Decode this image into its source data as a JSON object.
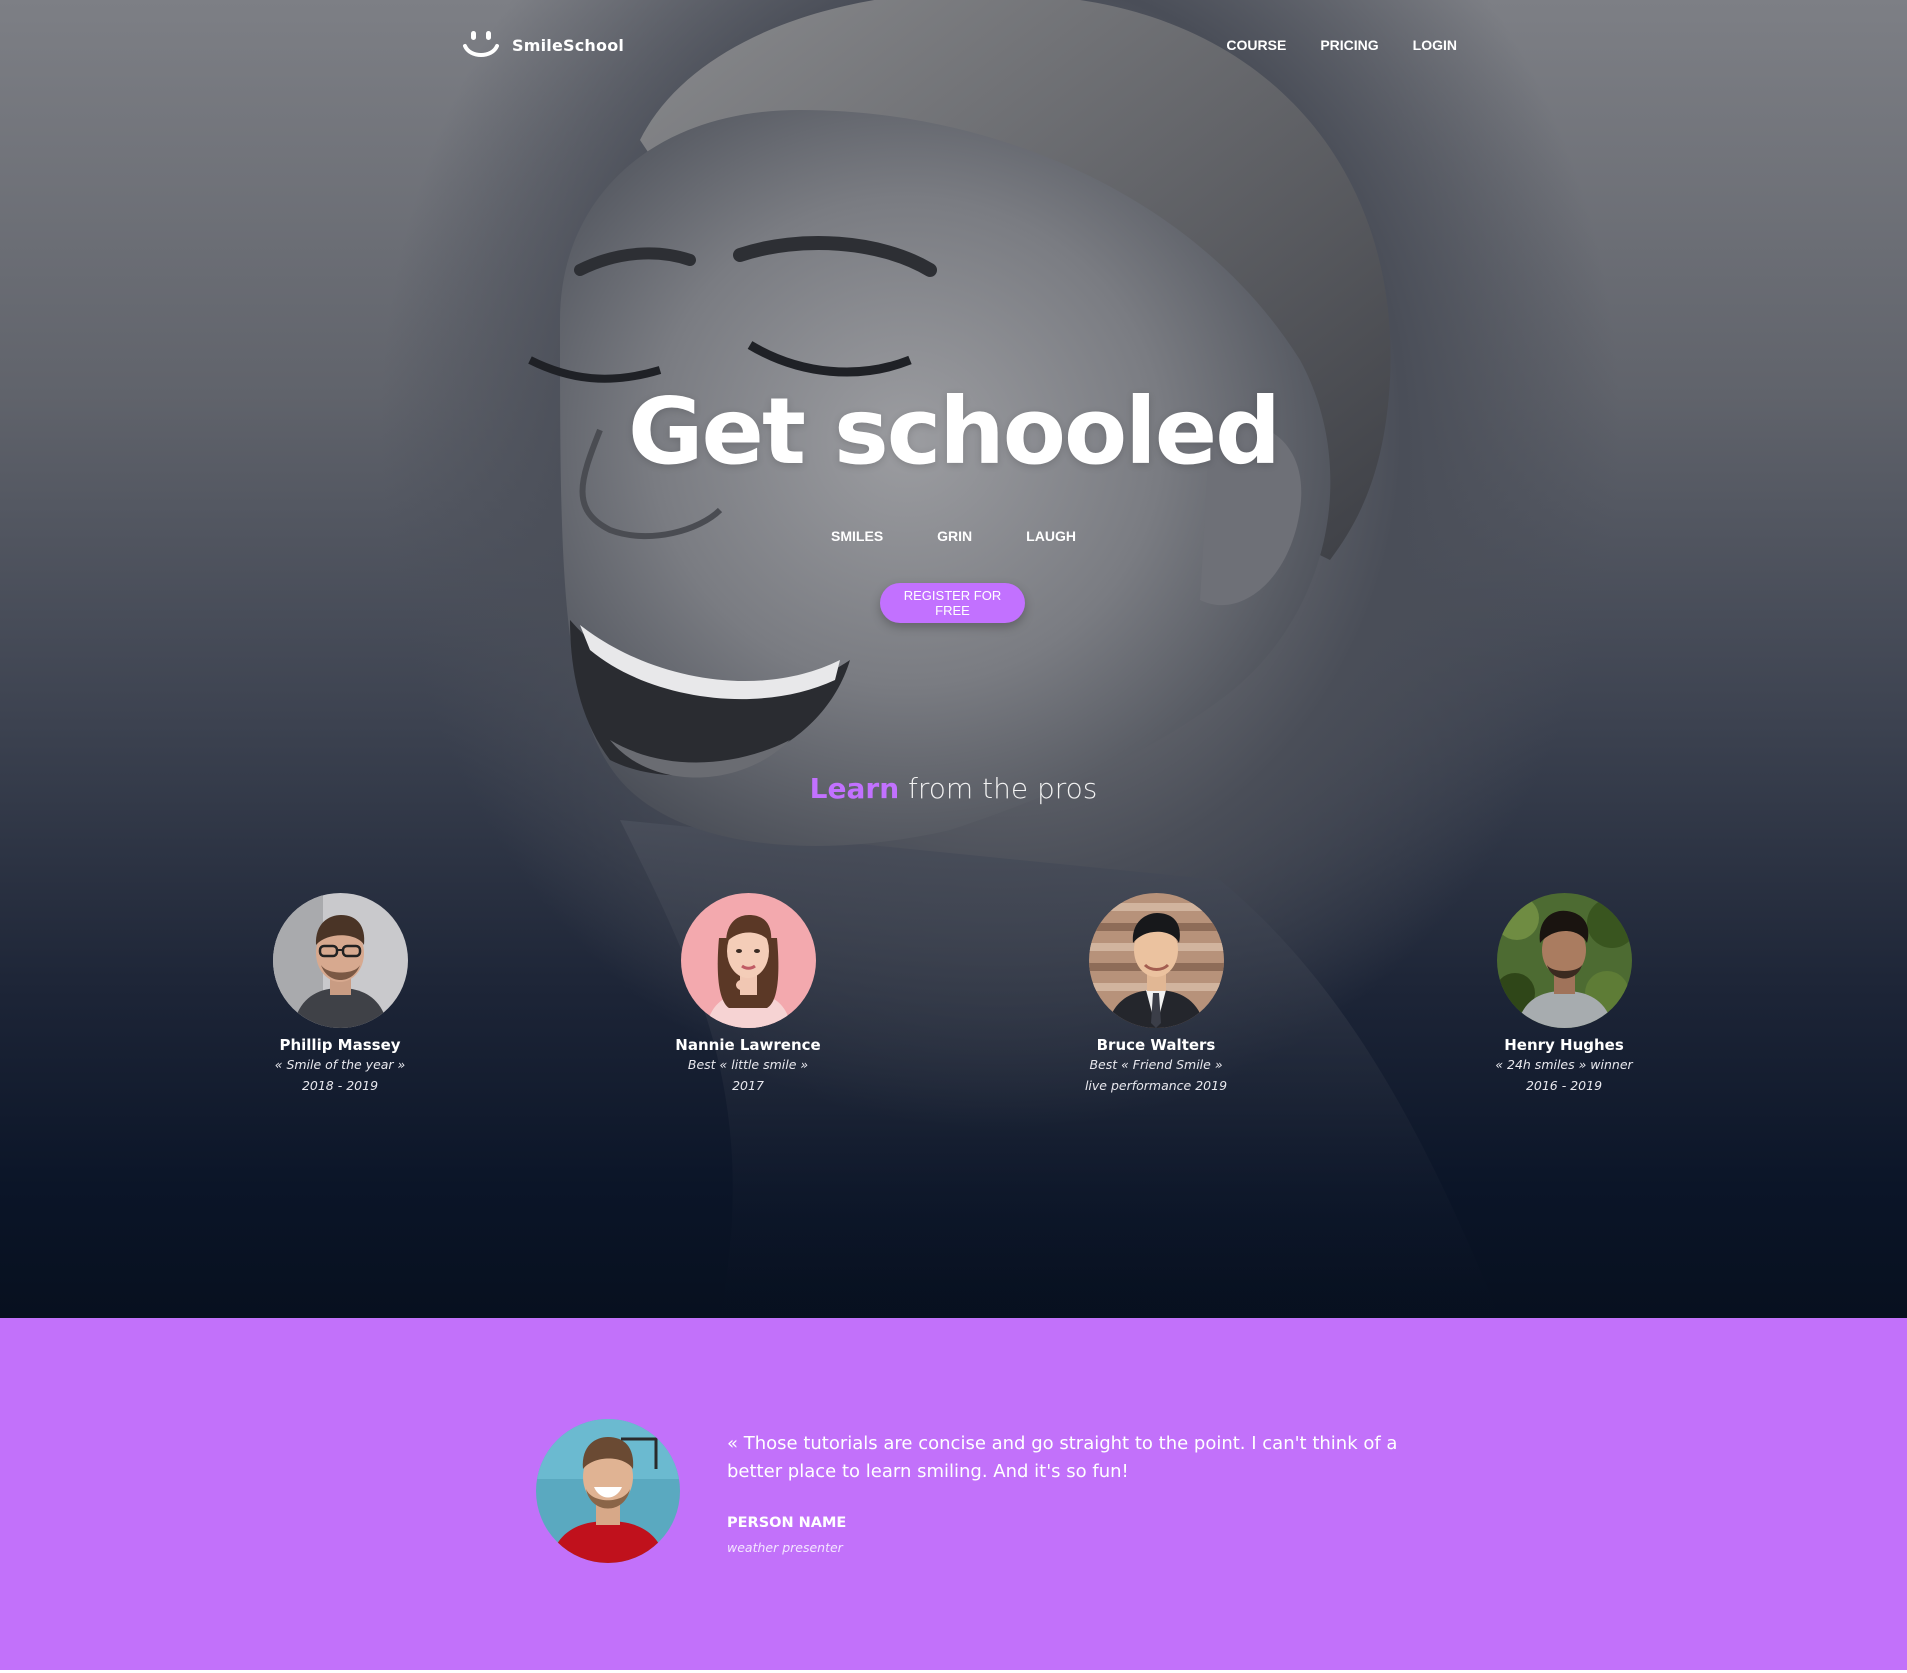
{
  "colors": {
    "accent": "#c271ff",
    "testimonial_bg": "#c271fa",
    "hero_dark": "#0b1528"
  },
  "nav": {
    "brand": "SmileSchool",
    "logo_icon": "smile-face-icon",
    "links": [
      {
        "label": "COURSE"
      },
      {
        "label": "PRICING"
      },
      {
        "label": "LOGIN"
      }
    ]
  },
  "hero": {
    "title": "Get schooled",
    "tags": [
      "SMILES",
      "GRIN",
      "LAUGH"
    ],
    "cta": "REGISTER FOR FREE"
  },
  "pros": {
    "heading_accent": "Learn",
    "heading_rest": "from the pros",
    "people": [
      {
        "name": "Phillip Massey",
        "line1": "« Smile of the year »",
        "line2": "2018 - 2019"
      },
      {
        "name": "Nannie Lawrence",
        "line1": "Best « little smile »",
        "line2": "2017"
      },
      {
        "name": "Bruce Walters",
        "line1": "Best « Friend Smile »",
        "line2": "live performance 2019"
      },
      {
        "name": "Henry Hughes",
        "line1": "« 24h smiles » winner",
        "line2": "2016 - 2019"
      }
    ]
  },
  "testimonial": {
    "quote": "« Those tutorials are concise and go straight to the point. I can't think of a better place to learn smiling. And it's so fun!",
    "person_name": "PERSON NAME",
    "person_role": "weather presenter"
  }
}
